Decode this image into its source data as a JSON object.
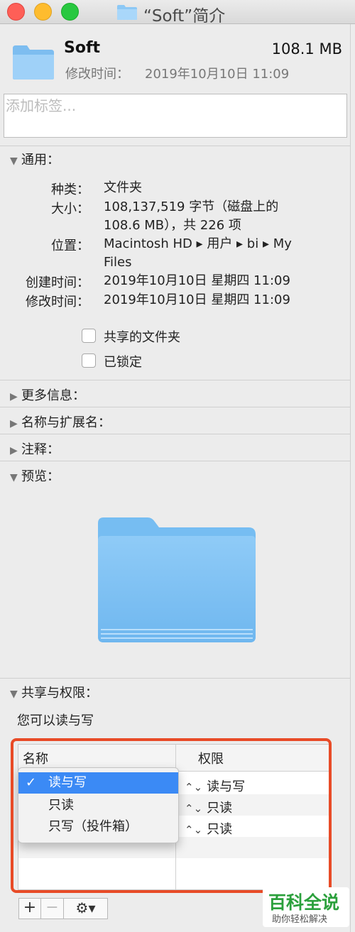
{
  "window": {
    "title": "“Soft”简介"
  },
  "header": {
    "name": "Soft",
    "size": "108.1 MB",
    "modified_label": "修改时间：",
    "modified_value": "2019年10月10日 11:09"
  },
  "tags": {
    "placeholder": "添加标签..."
  },
  "general": {
    "title": "通用：",
    "kind_label": "种类：",
    "kind_value": "文件夹",
    "size_label": "大小：",
    "size_value": "108,137,519 字节（磁盘上的 108.6 MB），共 226 项",
    "where_label": "位置：",
    "where_value": "Macintosh HD ▸ 用户 ▸ bi ▸ My Files",
    "created_label": "创建时间：",
    "created_value": "2019年10月10日 星期四 11:09",
    "modified_label": "修改时间：",
    "modified_value": "2019年10月10日 星期四 11:09",
    "shared_folder_label": "共享的文件夹",
    "locked_label": "已锁定"
  },
  "sections": {
    "more_info": "更多信息：",
    "name_ext": "名称与扩展名：",
    "comments": "注释：",
    "preview": "预览："
  },
  "sharing": {
    "title": "共享与权限：",
    "note": "您可以读与写",
    "col_name": "名称",
    "col_priv": "权限",
    "rows": [
      {
        "priv": "读与写"
      },
      {
        "priv": "只读"
      },
      {
        "priv": "只读"
      }
    ],
    "menu": [
      {
        "label": "读与写",
        "checked": true
      },
      {
        "label": "只读"
      },
      {
        "label": "只写（投件箱）"
      }
    ]
  },
  "toolbar": {
    "add": "+",
    "remove": "−",
    "gear": "⚙▾"
  },
  "watermark": {
    "big": "百科全说",
    "small": "助你轻松解决"
  }
}
